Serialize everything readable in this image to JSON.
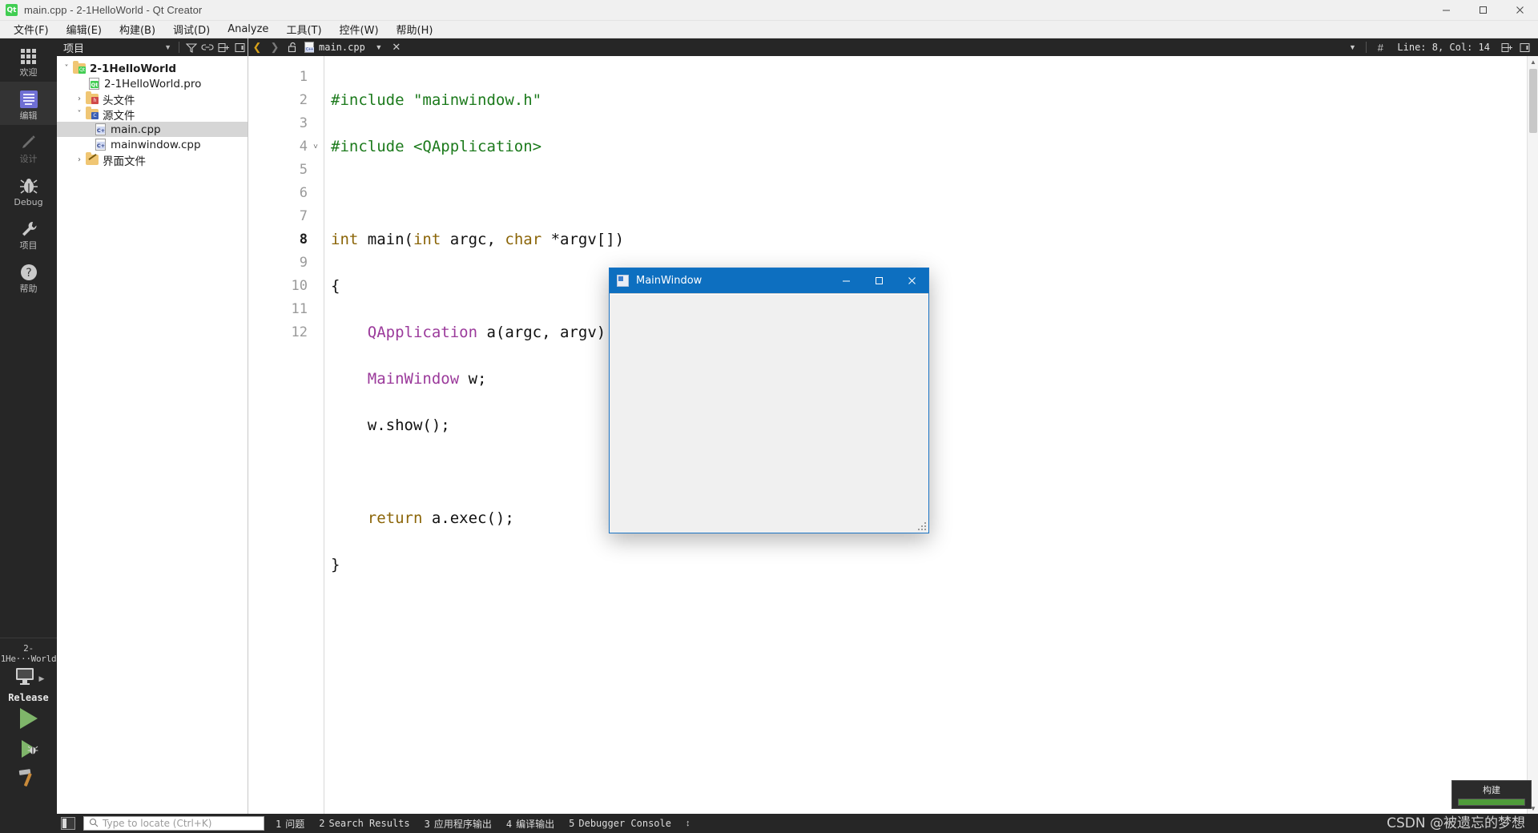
{
  "window": {
    "title": "main.cpp - 2-1HelloWorld - Qt Creator",
    "app_icon": "qt-logo-icon",
    "minimize": "minimize-icon",
    "maximize": "maximize-icon",
    "close": "close-icon"
  },
  "menubar": {
    "items": [
      {
        "label": "文件(F)",
        "key": "F"
      },
      {
        "label": "编辑(E)",
        "key": "E"
      },
      {
        "label": "构建(B)",
        "key": "B"
      },
      {
        "label": "调试(D)",
        "key": "D"
      },
      {
        "label": "Analyze",
        "key": "A"
      },
      {
        "label": "工具(T)",
        "key": "T"
      },
      {
        "label": "控件(W)",
        "key": "W"
      },
      {
        "label": "帮助(H)",
        "key": "H"
      }
    ]
  },
  "modebar": {
    "items": [
      {
        "label": "欢迎",
        "icon": "grid-icon",
        "active": false
      },
      {
        "label": "编辑",
        "icon": "document-lines-icon",
        "active": true
      },
      {
        "label": "设计",
        "icon": "pencil-icon",
        "active": false,
        "disabled": true
      },
      {
        "label": "Debug",
        "icon": "bug-icon",
        "active": false
      },
      {
        "label": "项目",
        "icon": "wrench-icon",
        "active": false
      },
      {
        "label": "帮助",
        "icon": "question-mark-icon",
        "active": false
      }
    ],
    "kit": {
      "project": "2-1He···World",
      "config": "Release",
      "icon": "desktop-monitor-icon",
      "run_button": "run-icon",
      "debug_button": "debug-run-icon",
      "build_button": "hammer-icon"
    }
  },
  "sidebar": {
    "header": {
      "title": "项目",
      "dropdown": "chevron-down-icon",
      "filter": "filter-icon",
      "sync": "link-icon",
      "split": "split-icon",
      "close": "close-panel-icon"
    },
    "tree": [
      {
        "label": "2-1HelloWorld",
        "depth": 0,
        "arrow": "v",
        "icon": "folder-qt-icon",
        "bold": true,
        "selected": false
      },
      {
        "label": "2-1HelloWorld.pro",
        "depth": 1,
        "arrow": "",
        "icon": "file-qt-icon",
        "bold": false,
        "selected": false
      },
      {
        "label": "头文件",
        "depth": 1,
        "arrow": ">",
        "icon": "folder-h-icon",
        "bold": false,
        "selected": false
      },
      {
        "label": "源文件",
        "depth": 1,
        "arrow": "v",
        "icon": "folder-cpp-icon",
        "bold": false,
        "selected": false
      },
      {
        "label": "main.cpp",
        "depth": 2,
        "arrow": "",
        "icon": "file-cpp-icon",
        "bold": false,
        "selected": true
      },
      {
        "label": "mainwindow.cpp",
        "depth": 2,
        "arrow": "",
        "icon": "file-cpp-icon",
        "bold": false,
        "selected": false
      },
      {
        "label": "界面文件",
        "depth": 1,
        "arrow": ">",
        "icon": "folder-ui-icon",
        "bold": false,
        "selected": false
      }
    ]
  },
  "editor_toolbar": {
    "back": "back-arrow-icon",
    "forward": "forward-arrow-icon",
    "lock": "unlock-icon",
    "tab": {
      "label": "main.cpp",
      "icon": "file-cpp-icon",
      "close": "close-tab-icon"
    },
    "dropdown": "chevron-down-icon",
    "symbol_icon": "hash-icon",
    "cursor_position": "Line: 8, Col: 14",
    "split_button": "split-horizontal-icon",
    "fullscreen_button": "expand-icon"
  },
  "editor": {
    "lines": [
      {
        "n": "1",
        "fold": "",
        "current": false,
        "tokens": [
          {
            "t": "#include ",
            "c": "pre"
          },
          {
            "t": "\"mainwindow.h\"",
            "c": "str"
          }
        ]
      },
      {
        "n": "2",
        "fold": "",
        "current": false,
        "tokens": [
          {
            "t": "#include ",
            "c": "pre"
          },
          {
            "t": "<QApplication>",
            "c": "str"
          }
        ]
      },
      {
        "n": "3",
        "fold": "",
        "current": false,
        "tokens": []
      },
      {
        "n": "4",
        "fold": "v",
        "current": false,
        "tokens": [
          {
            "t": "int",
            "c": "kw"
          },
          {
            "t": " main(",
            "c": "id"
          },
          {
            "t": "int",
            "c": "kw"
          },
          {
            "t": " argc, ",
            "c": "id"
          },
          {
            "t": "char",
            "c": "kw"
          },
          {
            "t": " *argv[])",
            "c": "id"
          }
        ]
      },
      {
        "n": "5",
        "fold": "",
        "current": false,
        "tokens": [
          {
            "t": "{",
            "c": "id"
          }
        ]
      },
      {
        "n": "6",
        "fold": "",
        "current": false,
        "tokens": [
          {
            "t": "    ",
            "c": "id"
          },
          {
            "t": "QApplication",
            "c": "type"
          },
          {
            "t": " a(argc, argv);",
            "c": "id"
          }
        ]
      },
      {
        "n": "7",
        "fold": "",
        "current": false,
        "tokens": [
          {
            "t": "    ",
            "c": "id"
          },
          {
            "t": "MainWindow",
            "c": "type"
          },
          {
            "t": " w;",
            "c": "id"
          }
        ]
      },
      {
        "n": "8",
        "fold": "",
        "current": true,
        "tokens": [
          {
            "t": "    w.show();",
            "c": "id"
          }
        ]
      },
      {
        "n": "9",
        "fold": "",
        "current": false,
        "tokens": []
      },
      {
        "n": "10",
        "fold": "",
        "current": false,
        "tokens": [
          {
            "t": "    ",
            "c": "id"
          },
          {
            "t": "return",
            "c": "kw"
          },
          {
            "t": " a.exec();",
            "c": "id"
          }
        ]
      },
      {
        "n": "11",
        "fold": "",
        "current": false,
        "tokens": [
          {
            "t": "}",
            "c": "id"
          }
        ]
      },
      {
        "n": "12",
        "fold": "",
        "current": false,
        "tokens": []
      }
    ]
  },
  "app_window": {
    "title": "MainWindow",
    "icon": "app-window-icon",
    "minimize": "minimize-icon",
    "maximize": "maximize-icon",
    "close": "close-icon",
    "resize_grip": "resize-grip-icon"
  },
  "build_popup": {
    "label": "构建",
    "progress": 100
  },
  "statusbar": {
    "sidebar_toggle": "toggle-sidebar-icon",
    "locator_placeholder": "Type to locate (Ctrl+K)",
    "search_icon": "search-icon",
    "panes": [
      {
        "n": "1",
        "label": "问题"
      },
      {
        "n": "2",
        "label": "Search Results"
      },
      {
        "n": "3",
        "label": "应用程序输出"
      },
      {
        "n": "4",
        "label": "编译输出"
      },
      {
        "n": "5",
        "label": "Debugger Console"
      }
    ],
    "stepper": "up-down-arrows-icon",
    "watermark": "CSDN @被遗忘的梦想"
  },
  "colors": {
    "accent": "#0d6fc0",
    "mode_bar": "#262626",
    "selection": "#d6d6d6",
    "qt_green": "#41cd52",
    "run_green": "#7fb56a"
  }
}
